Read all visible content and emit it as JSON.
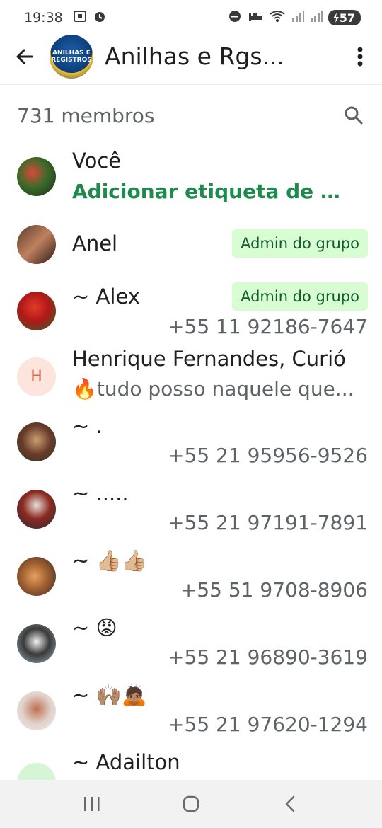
{
  "status_bar": {
    "time": "19:38",
    "battery": "57",
    "icons": [
      "screenshot-icon",
      "alarm-icon",
      "dnd-icon",
      "sleep-icon",
      "wifi-icon",
      "signal-icon",
      "signal-icon",
      "battery-icon"
    ]
  },
  "app_bar": {
    "title": "Anilhas e Rgs...",
    "avatar_text": "ANILHAS E REGISTROS"
  },
  "members": {
    "count_label": "731 membros"
  },
  "list": [
    {
      "name": "Você",
      "link": "Adicionar etiqueta de mem..."
    },
    {
      "name": "Anel",
      "badge": "Admin do grupo"
    },
    {
      "name": "~ Alex",
      "badge": "Admin do grupo",
      "phone": "+55 11 92186-7647"
    },
    {
      "name": "Henrique Fernandes, Curió",
      "status": "🔥tudo posso naquele que...",
      "initial": "H"
    },
    {
      "name": "~ .",
      "phone": "+55 21 95956-9526"
    },
    {
      "name": "~ .....",
      "phone": "+55 21 97191-7891"
    },
    {
      "name": "~ 👍🏼👍🏼",
      "phone": "+55 51 9708-8906"
    },
    {
      "name": "~ 😡",
      "phone": "+55 21 96890-3619"
    },
    {
      "name": "~ 🙌🏽🙇🏽",
      "phone": "+55 21 97620-1294"
    },
    {
      "name": "~ Adailton"
    }
  ],
  "colors": {
    "accent_green": "#1e8a4e",
    "badge_bg": "#d8fdd2",
    "badge_text": "#115c2f",
    "secondary_text": "#5f6368"
  }
}
